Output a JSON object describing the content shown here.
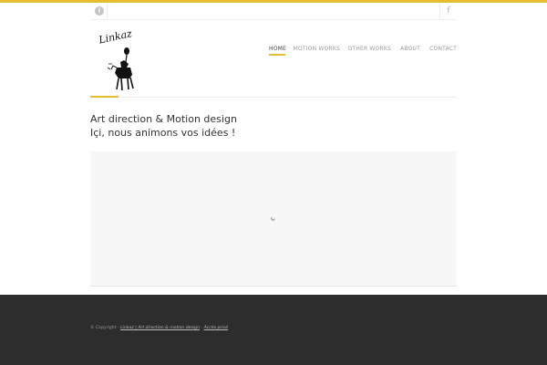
{
  "utility_bar": {
    "left_icon": "info-icon",
    "left_glyph": "i",
    "right_icon": "facebook-icon",
    "right_glyph": "f"
  },
  "logo": {
    "text": "Linkaz",
    "alt": "Linkaz logo"
  },
  "nav": {
    "items": [
      {
        "label": "HOME",
        "active": true
      },
      {
        "label": "MOTION WORKS",
        "active": false
      },
      {
        "label": "OTHER WORKS",
        "active": false
      },
      {
        "label": "ABOUT",
        "active": false
      },
      {
        "label": "CONTACT",
        "active": false
      }
    ]
  },
  "intro": {
    "line1": "Art direction & Motion design",
    "line2": "Içi, nous animons vos idées !"
  },
  "video": {
    "state": "loading"
  },
  "footer": {
    "prefix": "© Copyright - ",
    "site_link": "Linkaz | Art direction & motion design",
    "separator": " - ",
    "private_link": "Accès privé"
  },
  "colors": {
    "accent": "#e6bd2f",
    "footer_bg": "#2d2d2d"
  }
}
